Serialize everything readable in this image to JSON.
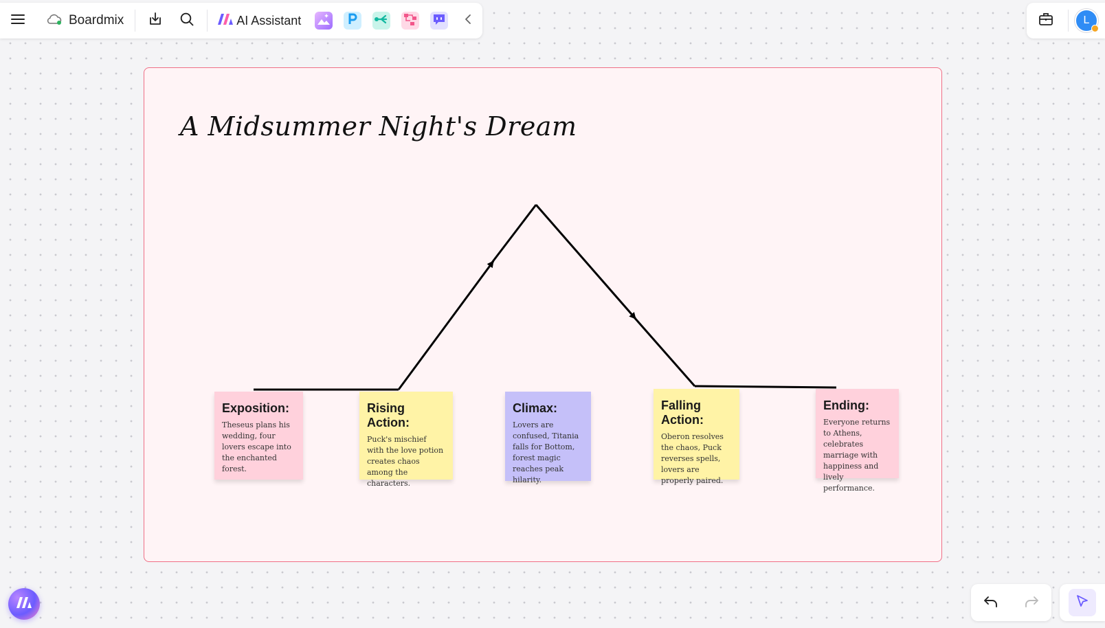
{
  "app": {
    "name": "Boardmix",
    "ai_assistant_label": "AI Assistant",
    "user_initial": "L"
  },
  "icons": {
    "menu": "menu-icon",
    "cloud": "cloud-sync-icon",
    "download": "download-icon",
    "search": "search-icon",
    "ai": "ai-assistant-logo-icon",
    "image_gen": "ai-image-icon",
    "ppt": "ai-presentation-icon",
    "mindmap": "ai-mindmap-icon",
    "flowchart": "ai-flowchart-icon",
    "chat": "ai-chat-icon",
    "collapse": "chevron-left-icon",
    "toolbox": "toolbox-icon",
    "undo": "undo-icon",
    "redo": "redo-icon",
    "select": "select-cursor-icon"
  },
  "colors": {
    "frame_border": "#ef6f86",
    "frame_fill": "#fff4f6",
    "sticky_pink": "#ffd1dc",
    "sticky_yellow": "#fff3a6",
    "sticky_purple": "#c5c0f9",
    "accent": "#6b5cff"
  },
  "board": {
    "title": "A Midsummer Night's Dream"
  },
  "stages": [
    {
      "title": "Exposition:",
      "body": "Theseus plans his wedding, four lovers escape into the enchanted forest."
    },
    {
      "title": "Rising Action:",
      "body": "Puck's mischief with the love potion creates chaos among the characters."
    },
    {
      "title": "Climax:",
      "body": "Lovers are confused, Titania falls for Bottom, forest magic reaches peak hilarity."
    },
    {
      "title": "Falling Action:",
      "body": "Oberon resolves the chaos, Puck reverses spells, lovers are properly paired."
    },
    {
      "title": "Ending:",
      "body": "Everyone returns to Athens, celebrates marriage with happiness and lively performance."
    }
  ]
}
